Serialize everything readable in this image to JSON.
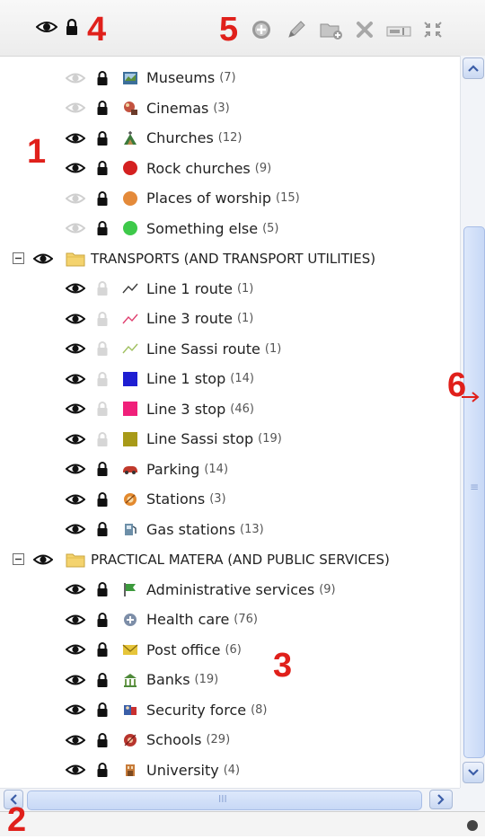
{
  "markers": {
    "m1": "1",
    "m2": "2",
    "m3": "3",
    "m4": "4",
    "m5": "5",
    "m6": "6"
  },
  "toolbar": {
    "icons": [
      "eye-icon",
      "lock-icon",
      "add-icon",
      "edit-icon",
      "folder-add-icon",
      "delete-icon",
      "rename-icon",
      "collapse-icon"
    ]
  },
  "groups": [
    {
      "label": "TRANSPORTS (AND TRANSPORT UTILITIES)"
    },
    {
      "label": "PRACTICAL MATERA (AND PUBLIC SERVICES)"
    }
  ],
  "items": [
    {
      "label": "Museums",
      "count": "(7)",
      "eye": "dim",
      "lock": "dark",
      "symbol": "museum-icon"
    },
    {
      "label": "Cinemas",
      "count": "(3)",
      "eye": "dim",
      "lock": "dark",
      "symbol": "cinema-icon"
    },
    {
      "label": "Churches",
      "count": "(12)",
      "eye": "dark",
      "lock": "dark",
      "symbol": "church-icon"
    },
    {
      "label": "Rock churches",
      "count": "(9)",
      "eye": "dark",
      "lock": "dark",
      "symbol": "dot",
      "color": "#d42020"
    },
    {
      "label": "Places of worship",
      "count": "(15)",
      "eye": "dim",
      "lock": "dark",
      "symbol": "dot",
      "color": "#e48a3a"
    },
    {
      "label": "Something else",
      "count": "(5)",
      "eye": "dim",
      "lock": "dark",
      "symbol": "dot",
      "color": "#3ec94a"
    },
    {
      "label": "Line 1 route",
      "count": "(1)",
      "eye": "dark",
      "lock": "dim",
      "symbol": "line",
      "color": "#3a3a3a"
    },
    {
      "label": "Line 3 route",
      "count": "(1)",
      "eye": "dark",
      "lock": "dim",
      "symbol": "line",
      "color": "#e04070"
    },
    {
      "label": "Line Sassi route",
      "count": "(1)",
      "eye": "dark",
      "lock": "dim",
      "symbol": "line",
      "color": "#a0c060"
    },
    {
      "label": "Line 1 stop",
      "count": "(14)",
      "eye": "dark",
      "lock": "dim",
      "symbol": "square",
      "color": "#1e1ed2"
    },
    {
      "label": "Line 3 stop",
      "count": "(46)",
      "eye": "dark",
      "lock": "dim",
      "symbol": "square",
      "color": "#f0207a"
    },
    {
      "label": "Line Sassi stop",
      "count": "(19)",
      "eye": "dark",
      "lock": "dim",
      "symbol": "square",
      "color": "#a89a18"
    },
    {
      "label": "Parking",
      "count": "(14)",
      "eye": "dark",
      "lock": "dark",
      "symbol": "parking-icon"
    },
    {
      "label": "Stations",
      "count": "(3)",
      "eye": "dark",
      "lock": "dark",
      "symbol": "station-icon"
    },
    {
      "label": "Gas stations",
      "count": "(13)",
      "eye": "dark",
      "lock": "dark",
      "symbol": "gas-station-icon"
    },
    {
      "label": "Administrative services",
      "count": "(9)",
      "eye": "dark",
      "lock": "dark",
      "symbol": "flag-icon"
    },
    {
      "label": "Health care",
      "count": "(76)",
      "eye": "dark",
      "lock": "dark",
      "symbol": "health-icon"
    },
    {
      "label": "Post office",
      "count": "(6)",
      "eye": "dark",
      "lock": "dark",
      "symbol": "post-icon"
    },
    {
      "label": "Banks",
      "count": "(19)",
      "eye": "dark",
      "lock": "dark",
      "symbol": "bank-icon"
    },
    {
      "label": "Security force",
      "count": "(8)",
      "eye": "dark",
      "lock": "dark",
      "symbol": "security-icon"
    },
    {
      "label": "Schools",
      "count": "(29)",
      "eye": "dark",
      "lock": "dark",
      "symbol": "school-icon"
    },
    {
      "label": "University",
      "count": "(4)",
      "eye": "dark",
      "lock": "dark",
      "symbol": "university-icon"
    }
  ],
  "scroll": {
    "hthumb_grip": "III",
    "vthumb_grip": "≡"
  }
}
